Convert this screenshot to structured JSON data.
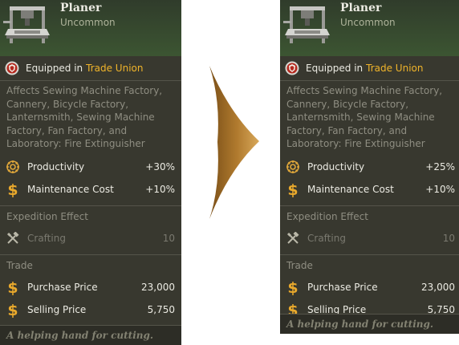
{
  "before": {
    "item_name": "Planer",
    "rarity": "Uncommon",
    "equipped_prefix": "Equipped in",
    "equipped_faction": "Trade Union",
    "affects": "Affects Sewing Machine Factory, Cannery, Bicycle Factory, Lanternsmith, Sewing Machine Factory, Fan Factory, and Laboratory: Fire Extinguisher",
    "stats": [
      {
        "label": "Productivity",
        "value": "+30%",
        "icon": "gear-icon"
      },
      {
        "label": "Maintenance Cost",
        "value": "+10%",
        "icon": "dollar-icon"
      }
    ],
    "expedition_title": "Expedition Effect",
    "expedition_stat": {
      "label": "Crafting",
      "value": "10",
      "icon": "crossed-tools-icon"
    },
    "trade_title": "Trade",
    "trade": [
      {
        "label": "Purchase Price",
        "value": "23,000",
        "icon": "dollar-icon"
      },
      {
        "label": "Selling Price",
        "value": "5,750",
        "icon": "dollar-icon"
      }
    ],
    "flavor": "A helping hand for cutting."
  },
  "after": {
    "item_name": "Planer",
    "rarity": "Uncommon",
    "equipped_prefix": "Equipped in",
    "equipped_faction": "Trade Union",
    "affects": "Affects Sewing Machine Factory, Cannery, Bicycle Factory, Lanternsmith, Sewing Machine Factory, Fan Factory, and Laboratory: Fire Extinguisher",
    "stats": [
      {
        "label": "Productivity",
        "value": "+25%",
        "icon": "gear-icon"
      },
      {
        "label": "Maintenance Cost",
        "value": "+10%",
        "icon": "dollar-icon"
      }
    ],
    "expedition_title": "Expedition Effect",
    "expedition_stat": {
      "label": "Crafting",
      "value": "10",
      "icon": "crossed-tools-icon"
    },
    "trade_title": "Trade",
    "trade": [
      {
        "label": "Purchase Price",
        "value": "23,000",
        "icon": "dollar-icon"
      },
      {
        "label": "Selling Price",
        "value": "5,750",
        "icon": "dollar-icon"
      }
    ],
    "flavor": "A helping hand for cutting."
  },
  "colors": {
    "card_bg": "#38382f",
    "header_green": "#3c5532",
    "faction_gold": "#f0b42a",
    "dollar_gold": "#e9a92c",
    "arrow_brown": "#b07a2e"
  }
}
